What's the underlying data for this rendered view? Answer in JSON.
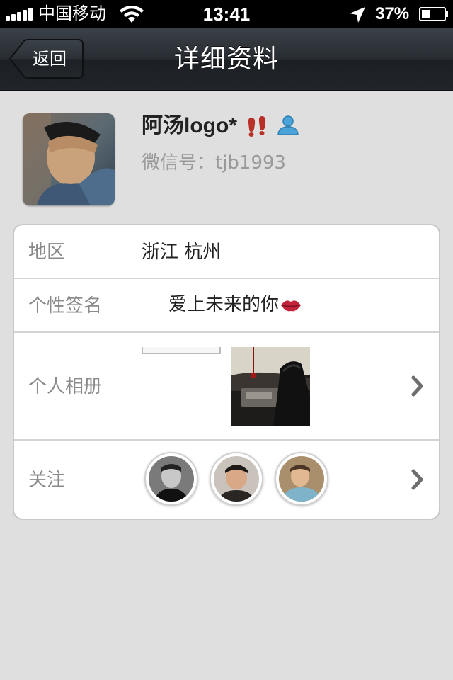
{
  "status_bar": {
    "carrier": "中国移动",
    "time": "13:41",
    "battery": "37%"
  },
  "nav": {
    "back_label": "返回",
    "title": "详细资料"
  },
  "profile": {
    "name": "阿汤logo*",
    "wechat_id": "微信号：tjb1993"
  },
  "details": {
    "region": {
      "label": "地区",
      "value": "浙江 杭州"
    },
    "signature": {
      "label": "个性签名",
      "value": "爱上未来的你"
    },
    "album": {
      "label": "个人相册"
    },
    "following": {
      "label": "关注",
      "count_shown": 3
    }
  },
  "colors": {
    "background": "#e0dfdf",
    "nav_bar": "#262b30",
    "label_gray": "#8a8a8a",
    "id_gray": "#9a9a9a",
    "contact_icon_blue": "#4aa3d9",
    "footprint_red": "#c0392b"
  },
  "icons": [
    "signal-icon",
    "wifi-icon",
    "location-arrow-icon",
    "battery-icon",
    "back-arrow-icon",
    "footprint-icon",
    "contact-icon",
    "lips-icon",
    "chevron-right-icon"
  ]
}
